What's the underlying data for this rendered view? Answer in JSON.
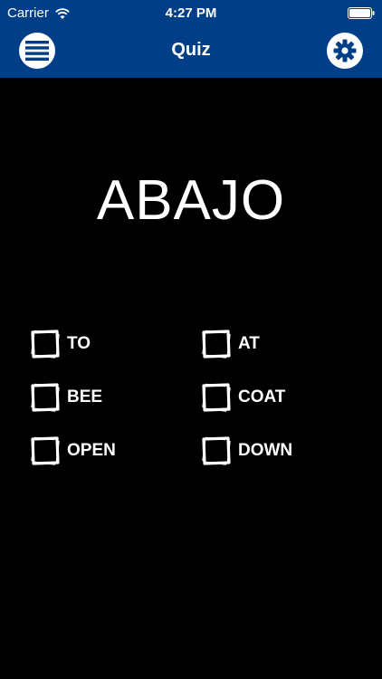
{
  "status_bar": {
    "carrier": "Carrier",
    "time": "4:27 PM",
    "wifi_icon": "wifi-icon",
    "battery_icon": "battery-icon"
  },
  "nav": {
    "title": "Quiz",
    "menu_icon": "list-icon",
    "settings_icon": "gear-icon"
  },
  "quiz": {
    "word": "ABAJO",
    "options": [
      {
        "label": "TO"
      },
      {
        "label": "AT"
      },
      {
        "label": "BEE"
      },
      {
        "label": "COAT"
      },
      {
        "label": "OPEN"
      },
      {
        "label": "DOWN"
      }
    ]
  },
  "colors": {
    "header": "#003F87",
    "background": "#000000",
    "text": "#FFFFFF"
  }
}
